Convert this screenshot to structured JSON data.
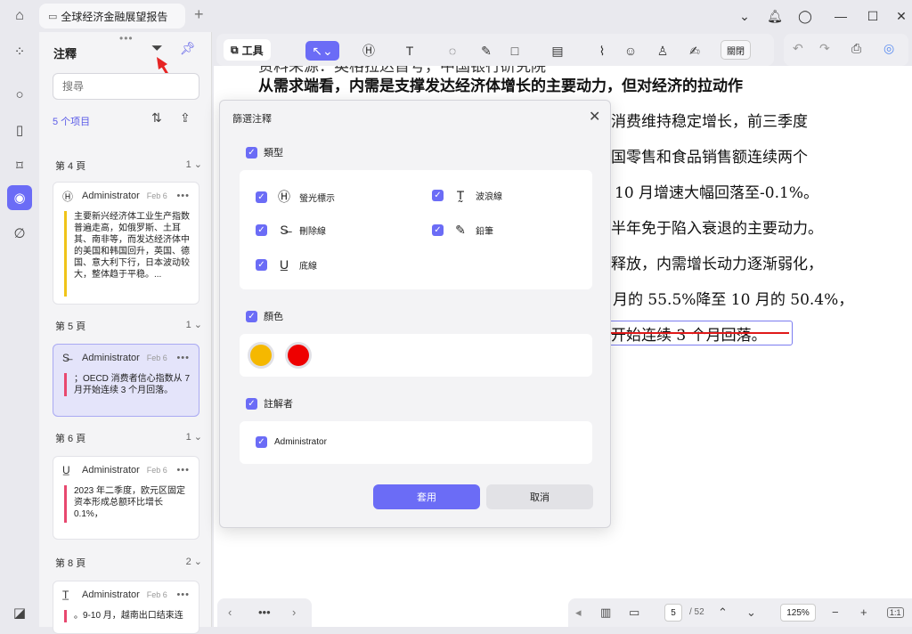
{
  "window": {
    "tab_title": "全球经济金融展望报告"
  },
  "sidebar": {
    "title": "注釋",
    "search_placeholder": "搜尋",
    "count": "5 个项目",
    "groups": [
      {
        "page": "第 4 頁",
        "count": "1",
        "author": "Administrator",
        "date": "Feb 6",
        "type_icon": "H",
        "text": "主要新兴经济体工业生产指数普遍走高，如俄罗斯、土耳其、南非等，而发达经济体中的美国和韩国回升，英国、德国、意大利下行，日本波动较大，整体趋于平稳。..."
      },
      {
        "page": "第 5 頁",
        "count": "1",
        "author": "Administrator",
        "date": "Feb 6",
        "type_icon": "S",
        "text": "；OECD 消费者信心指数从 7 月开始连续 3 个月回落。"
      },
      {
        "page": "第 6 頁",
        "count": "1",
        "author": "Administrator",
        "date": "Feb 6",
        "type_icon": "U",
        "text": "2023 年二季度，欧元区固定资本形成总额环比增长 0.1%，"
      },
      {
        "page": "第 8 頁",
        "count": "2",
        "author": "Administrator",
        "date": "Feb 6",
        "type_icon": "T",
        "text": "。9-10 月，越南出口结束连"
      }
    ]
  },
  "toolbar": {
    "label": "工具",
    "close": "關閉"
  },
  "document": {
    "lines": [
      "资料来源：英格拉达首号，中国银行研究院",
      "从需求端看，内需是支撑发达经济体增长的主要动力，但对经济的拉动作",
      "消费维持稳定增长，前三季度",
      "国零售和食品销售额连续两个",
      "10 月增速大幅回落至-0.1%。",
      "半年免于陷入衰退的主要动力。",
      "释放，内需增长动力逐渐弱化，",
      "月的 55.5%降至 10 月的 50.4%，",
      "开始连续 3 个月回落。"
    ]
  },
  "dialog": {
    "title": "篩選注釋",
    "type_section": "類型",
    "types": [
      "螢光標示",
      "波浪線",
      "刪除線",
      "鉛筆",
      "底線"
    ],
    "color_section": "顏色",
    "colors": [
      "#f5b800",
      "#ee0000"
    ],
    "author_section": "註解者",
    "authors": [
      "Administrator"
    ],
    "apply": "套用",
    "cancel": "取消"
  },
  "footer": {
    "page": "5",
    "total": "/ 52",
    "zoom": "125%",
    "one_to_one": "1:1"
  }
}
